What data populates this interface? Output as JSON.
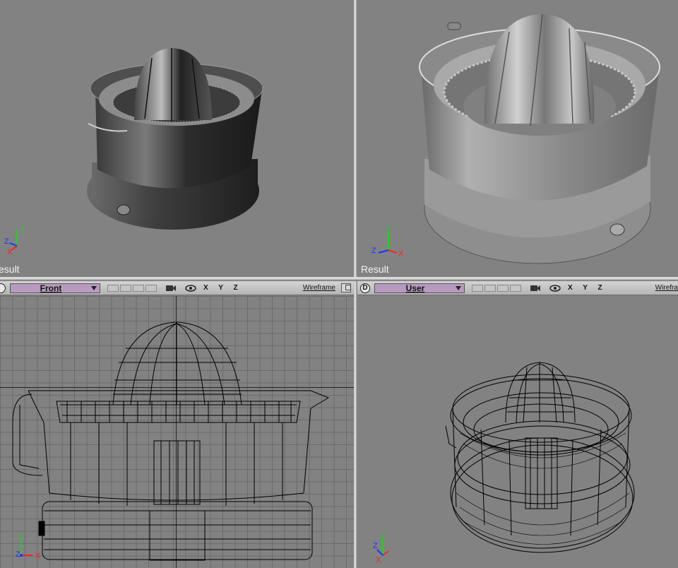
{
  "viewports": {
    "top_left": {
      "label": "esult"
    },
    "top_right": {
      "label": "Result"
    },
    "bottom_left": {
      "badge": "",
      "view": "Front",
      "axes": "X Y Z",
      "shading": "Wireframe"
    },
    "bottom_right": {
      "badge": "D",
      "view": "User",
      "axes": "X Y Z",
      "shading": "Wirefra"
    }
  },
  "axis_labels": {
    "x": "X",
    "y": "Y",
    "z": "Z"
  },
  "colors": {
    "viewport_bg": "#828282",
    "view_select": "#b79bbe",
    "axis_x": "#ff2020",
    "axis_y": "#20d020",
    "axis_z": "#2030ff"
  }
}
